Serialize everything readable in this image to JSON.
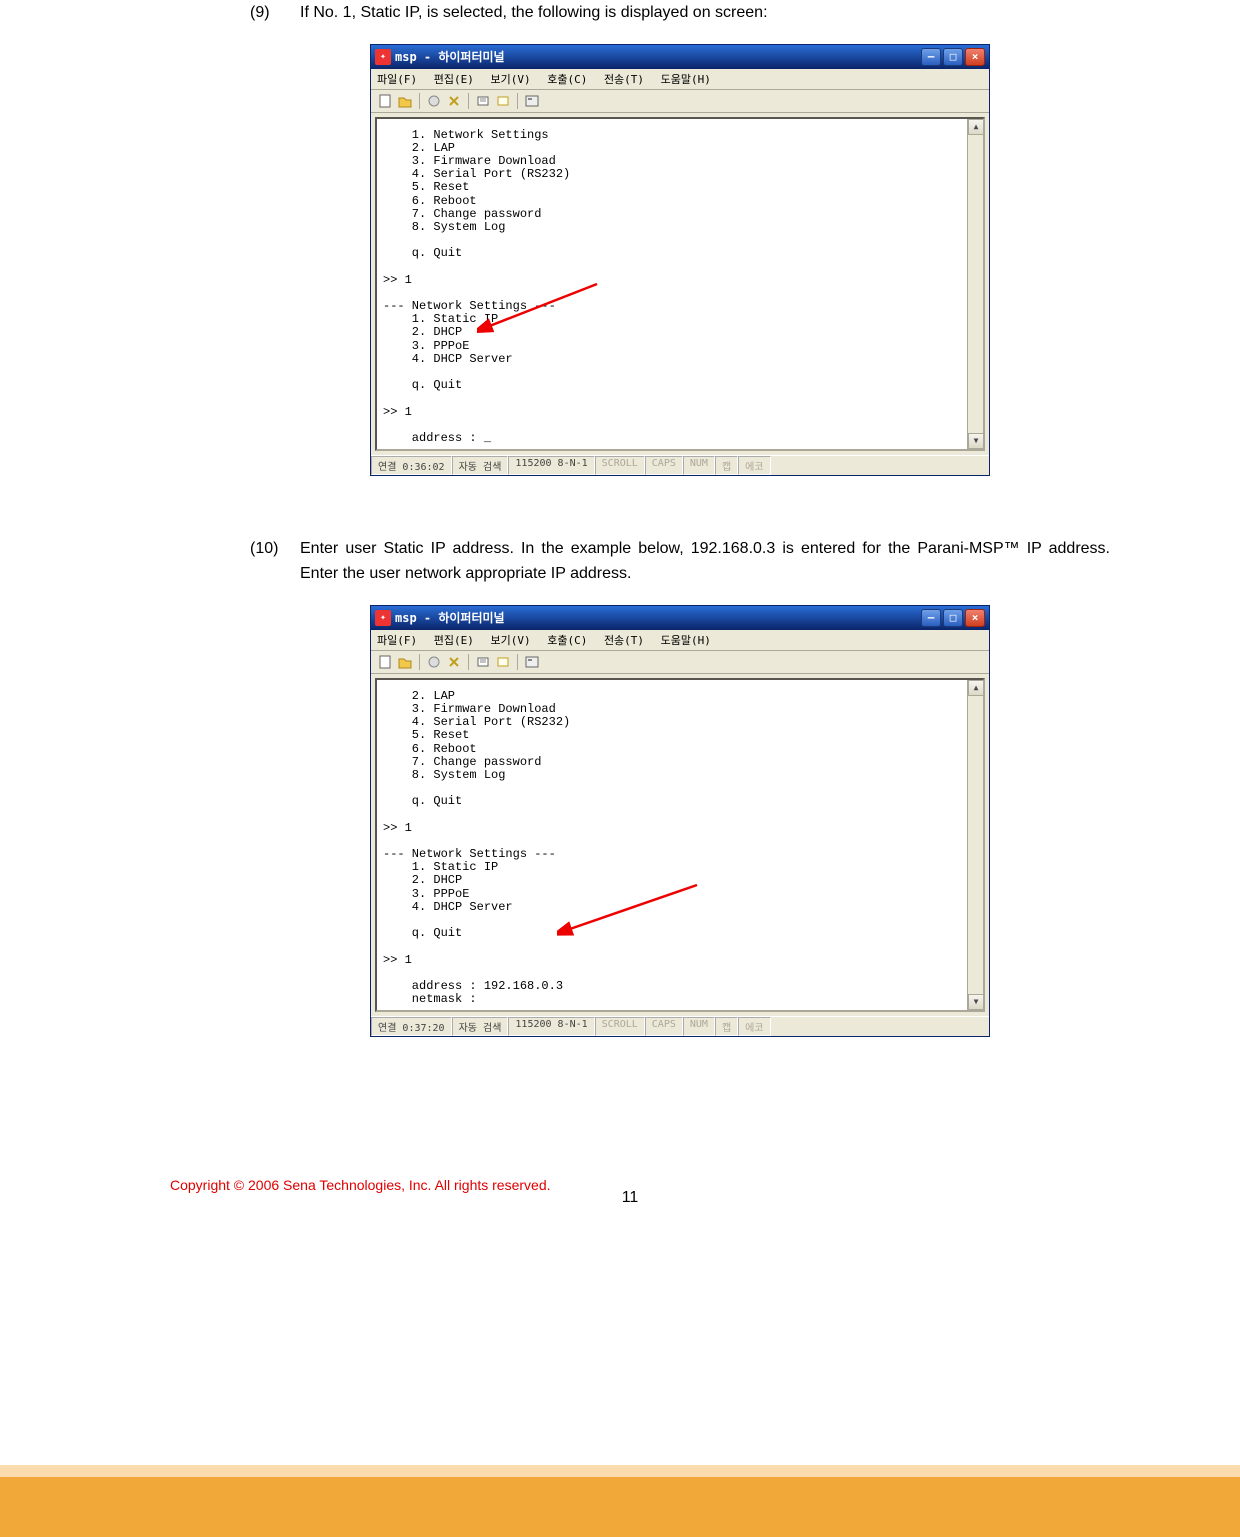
{
  "step9": {
    "num": "(9)",
    "text": "If No. 1, Static IP, is selected, the following is displayed on screen:"
  },
  "step10": {
    "num": "(10)",
    "text": "Enter user Static IP address.   In the example below, 192.168.0.3 is entered for the Parani-MSP™ IP address.   Enter the user network appropriate IP address."
  },
  "window1": {
    "title": "msp - 하이퍼터미널",
    "menu": {
      "m1": "파일(F)",
      "m2": "편집(E)",
      "m3": "보기(V)",
      "m4": "호출(C)",
      "m5": "전송(T)",
      "m6": "도움말(H)"
    },
    "term": "    1. Network Settings\n    2. LAP\n    3. Firmware Download\n    4. Serial Port (RS232)\n    5. Reset\n    6. Reboot\n    7. Change password\n    8. System Log\n\n    q. Quit\n\n>> 1\n\n--- Network Settings ---\n    1. Static IP\n    2. DHCP\n    3. PPPoE\n    4. DHCP Server\n\n    q. Quit\n\n>> 1\n\n    address : _",
    "status": {
      "s1": "연결 0:36:02",
      "s2": "자동 검색",
      "s3": "115200 8-N-1",
      "s4": "SCROLL",
      "s5": "CAPS",
      "s6": "NUM",
      "s7": "캡",
      "s8": "에코"
    }
  },
  "window2": {
    "title": "msp - 하이퍼터미널",
    "menu": {
      "m1": "파일(F)",
      "m2": "편집(E)",
      "m3": "보기(V)",
      "m4": "호출(C)",
      "m5": "전송(T)",
      "m6": "도움말(H)"
    },
    "term": "    2. LAP\n    3. Firmware Download\n    4. Serial Port (RS232)\n    5. Reset\n    6. Reboot\n    7. Change password\n    8. System Log\n\n    q. Quit\n\n>> 1\n\n--- Network Settings ---\n    1. Static IP\n    2. DHCP\n    3. PPPoE\n    4. DHCP Server\n\n    q. Quit\n\n>> 1\n\n    address : 192.168.0.3\n    netmask :",
    "status": {
      "s1": "연결 0:37:20",
      "s2": "자동 검색",
      "s3": "115200 8-N-1",
      "s4": "SCROLL",
      "s5": "CAPS",
      "s6": "NUM",
      "s7": "캡",
      "s8": "에코"
    }
  },
  "footer": {
    "copyright": "Copyright © 2006 Sena Technologies, Inc. All rights reserved.",
    "pagenum": "11"
  },
  "icons": {
    "new": "new-file",
    "open": "open-file",
    "print": "print",
    "prop": "properties",
    "connect": "connect",
    "disconnect": "disconnect",
    "send": "send"
  }
}
